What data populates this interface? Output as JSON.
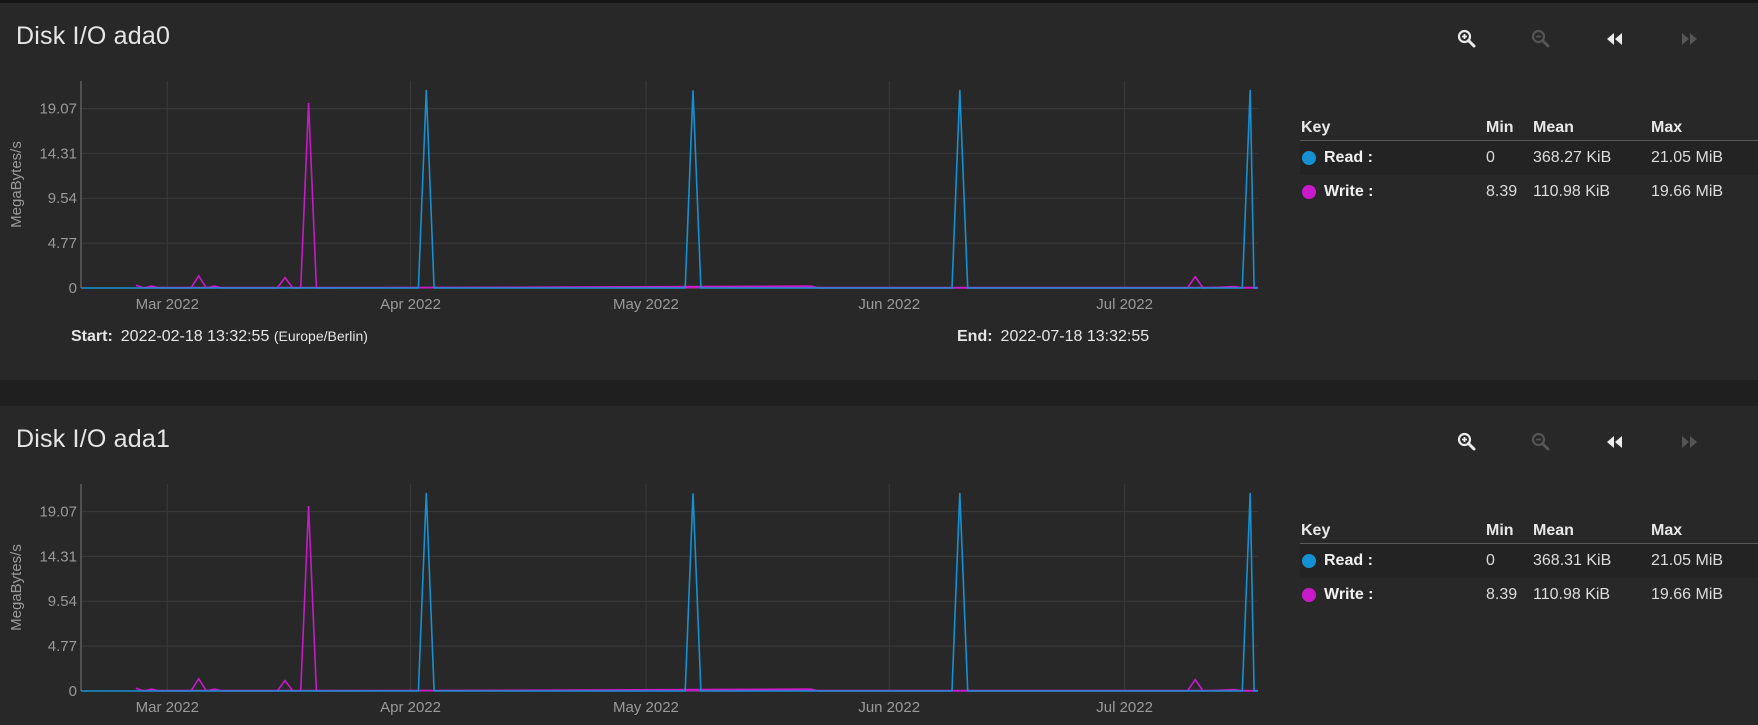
{
  "colors": {
    "read": "#1591d3",
    "write": "#c81ac9",
    "grid": "#3b3b3b",
    "axis": "#9a9a9a"
  },
  "panels": [
    {
      "title": "Disk I/O ada0",
      "toolbar": {
        "zoom_in": "zoom-in-icon",
        "zoom_out": "zoom-out-icon",
        "step_back": "rewind-icon",
        "step_forward": "fast-forward-icon"
      },
      "legend": {
        "headers": {
          "key": "Key",
          "min": "Min",
          "mean": "Mean",
          "max": "Max"
        },
        "rows": [
          {
            "name": "Read :",
            "min": "0",
            "mean": "368.27 KiB",
            "max": "21.05 MiB"
          },
          {
            "name": "Write :",
            "min": "8.39",
            "mean": "110.98 KiB",
            "max": "19.66 MiB"
          }
        ]
      },
      "start_label": "Start:",
      "start_value": "2022-02-18 13:32:55",
      "timezone": "(Europe/Berlin)",
      "end_label": "End:",
      "end_value": "2022-07-18 13:32:55"
    },
    {
      "title": "Disk I/O ada1",
      "toolbar": {
        "zoom_in": "zoom-in-icon",
        "zoom_out": "zoom-out-icon",
        "step_back": "rewind-icon",
        "step_forward": "fast-forward-icon"
      },
      "legend": {
        "headers": {
          "key": "Key",
          "min": "Min",
          "mean": "Mean",
          "max": "Max"
        },
        "rows": [
          {
            "name": "Read :",
            "min": "0",
            "mean": "368.31 KiB",
            "max": "21.05 MiB"
          },
          {
            "name": "Write :",
            "min": "8.39",
            "mean": "110.98 KiB",
            "max": "19.66 MiB"
          }
        ]
      }
    }
  ],
  "chart_data": [
    {
      "type": "line",
      "ylabel": "MegaBytes/s",
      "yticks": [
        0,
        4.77,
        9.54,
        14.31,
        19.07
      ],
      "ylim": [
        0,
        22
      ],
      "xlim": [
        "2022-02-18",
        "2022-07-18"
      ],
      "xticks": [
        {
          "date": "2022-03-01",
          "label": "Mar 2022"
        },
        {
          "date": "2022-04-01",
          "label": "Apr 2022"
        },
        {
          "date": "2022-05-01",
          "label": "May 2022"
        },
        {
          "date": "2022-06-01",
          "label": "Jun 2022"
        },
        {
          "date": "2022-07-01",
          "label": "Jul 2022"
        }
      ],
      "grid": true,
      "series": [
        {
          "name": "Read",
          "points": [
            [
              "2022-02-18",
              0
            ],
            [
              "2022-04-02",
              0
            ],
            [
              "2022-04-03",
              21.05
            ],
            [
              "2022-04-04",
              0
            ],
            [
              "2022-05-06",
              0
            ],
            [
              "2022-05-07",
              21.0
            ],
            [
              "2022-05-08",
              0
            ],
            [
              "2022-06-09",
              0
            ],
            [
              "2022-06-10",
              21.05
            ],
            [
              "2022-06-11",
              0
            ],
            [
              "2022-07-16",
              0
            ],
            [
              "2022-07-17",
              21.05
            ],
            [
              "2022-07-17T12:00",
              0
            ],
            [
              "2022-07-18",
              0
            ]
          ]
        },
        {
          "name": "Write",
          "points": [
            [
              "2022-02-25",
              0.3
            ],
            [
              "2022-02-26",
              0
            ],
            [
              "2022-02-27",
              0.2
            ],
            [
              "2022-02-28",
              0
            ],
            [
              "2022-03-04",
              0
            ],
            [
              "2022-03-05",
              1.3
            ],
            [
              "2022-03-06",
              0
            ],
            [
              "2022-03-07",
              0.2
            ],
            [
              "2022-03-08",
              0
            ],
            [
              "2022-03-15",
              0
            ],
            [
              "2022-03-16",
              1.1
            ],
            [
              "2022-03-17",
              0
            ],
            [
              "2022-03-18",
              0
            ],
            [
              "2022-03-19",
              19.66
            ],
            [
              "2022-03-20",
              0
            ],
            [
              "2022-05-22",
              0.2
            ],
            [
              "2022-05-23",
              0
            ],
            [
              "2022-07-09",
              0
            ],
            [
              "2022-07-10",
              1.2
            ],
            [
              "2022-07-11",
              0
            ],
            [
              "2022-07-15",
              0.15
            ],
            [
              "2022-07-16",
              0
            ],
            [
              "2022-07-18",
              0
            ]
          ]
        }
      ]
    },
    {
      "type": "line",
      "ylabel": "MegaBytes/s",
      "yticks": [
        0,
        4.77,
        9.54,
        14.31,
        19.07
      ],
      "ylim": [
        0,
        22
      ],
      "xlim": [
        "2022-02-18",
        "2022-07-18"
      ],
      "xticks": [
        {
          "date": "2022-03-01",
          "label": "Mar 2022"
        },
        {
          "date": "2022-04-01",
          "label": "Apr 2022"
        },
        {
          "date": "2022-05-01",
          "label": "May 2022"
        },
        {
          "date": "2022-06-01",
          "label": "Jun 2022"
        },
        {
          "date": "2022-07-01",
          "label": "Jul 2022"
        }
      ],
      "grid": true,
      "series": [
        {
          "name": "Read",
          "points": [
            [
              "2022-02-18",
              0
            ],
            [
              "2022-04-02",
              0
            ],
            [
              "2022-04-03",
              21.05
            ],
            [
              "2022-04-04",
              0
            ],
            [
              "2022-05-06",
              0
            ],
            [
              "2022-05-07",
              21.0
            ],
            [
              "2022-05-08",
              0
            ],
            [
              "2022-06-09",
              0
            ],
            [
              "2022-06-10",
              21.05
            ],
            [
              "2022-06-11",
              0
            ],
            [
              "2022-07-16",
              0
            ],
            [
              "2022-07-17",
              21.05
            ],
            [
              "2022-07-17T12:00",
              0
            ],
            [
              "2022-07-18",
              0
            ]
          ]
        },
        {
          "name": "Write",
          "points": [
            [
              "2022-02-25",
              0.3
            ],
            [
              "2022-02-26",
              0
            ],
            [
              "2022-02-27",
              0.2
            ],
            [
              "2022-02-28",
              0
            ],
            [
              "2022-03-04",
              0
            ],
            [
              "2022-03-05",
              1.3
            ],
            [
              "2022-03-06",
              0
            ],
            [
              "2022-03-07",
              0.2
            ],
            [
              "2022-03-08",
              0
            ],
            [
              "2022-03-15",
              0
            ],
            [
              "2022-03-16",
              1.1
            ],
            [
              "2022-03-17",
              0
            ],
            [
              "2022-03-18",
              0
            ],
            [
              "2022-03-19",
              19.66
            ],
            [
              "2022-03-20",
              0
            ],
            [
              "2022-05-22",
              0.2
            ],
            [
              "2022-05-23",
              0
            ],
            [
              "2022-07-09",
              0
            ],
            [
              "2022-07-10",
              1.2
            ],
            [
              "2022-07-11",
              0
            ],
            [
              "2022-07-15",
              0.15
            ],
            [
              "2022-07-16",
              0
            ],
            [
              "2022-07-18",
              0
            ]
          ]
        }
      ]
    }
  ]
}
